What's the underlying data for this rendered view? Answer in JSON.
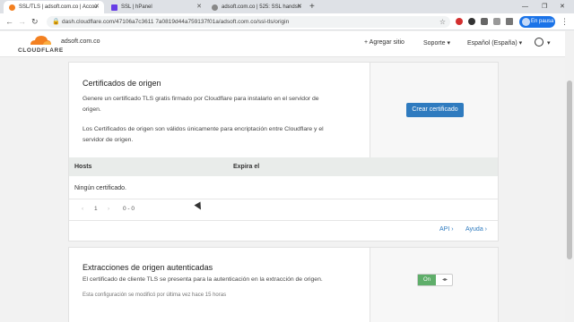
{
  "browser": {
    "tabs": [
      {
        "title": "SSL/TLS | adsoft.com.co | Accou",
        "favicon_color": "#f38020"
      },
      {
        "title": "SSL | hPanel",
        "favicon_color": "#673de6"
      },
      {
        "title": "adsoft.com.co | 525: SSL handsh",
        "favicon_color": "#888888"
      }
    ],
    "new_tab": "+",
    "controls": {
      "minimize": "—",
      "maximize": "❐",
      "close": "✕"
    },
    "url": "dash.cloudflare.com/47106a7c3611 7a0819d44a759137f01a/adsoft.com.co/ssl-tls/origin",
    "pause_label": "En pausa"
  },
  "header": {
    "logo_text": "CLOUDFLARE",
    "account": "adsoft.com.co",
    "add_site": "+ Agregar sitio",
    "support": "Soporte ▾",
    "language": "Español (España) ▾",
    "user_menu": "▾"
  },
  "origin_certs": {
    "title": "Certificados de origen",
    "desc1_line1": "Genere un certificado TLS gratis firmado por Cloudflare para instalarlo en el servidor de",
    "desc1_line2": "origen.",
    "desc2_line1": "Los Certificados de origen son válidos únicamente para encriptación entre Cloudflare y el",
    "desc2_line2": "servidor de origen.",
    "create_button": "Crear certificado",
    "col_hosts": "Hosts",
    "col_expires": "Expira el",
    "empty": "Ningún certificado.",
    "page_prev": "‹",
    "page_num": "1",
    "page_next": "›",
    "range": "0 - 0",
    "api_link": "API ›",
    "help_link": "Ayuda ›"
  },
  "auth_pulls": {
    "title": "Extracciones de origen autenticadas",
    "desc": "El certificado de cliente TLS se presenta para la autenticación en la extracción de origen.",
    "modified": "Esta configuración se modificó por última vez hace 15 horas",
    "toggle_on": "On",
    "toggle_off": "◂▸"
  },
  "colors": {
    "accent": "#2f7bbf",
    "brand": "#f38020",
    "toggle_on": "#5fae6a"
  }
}
